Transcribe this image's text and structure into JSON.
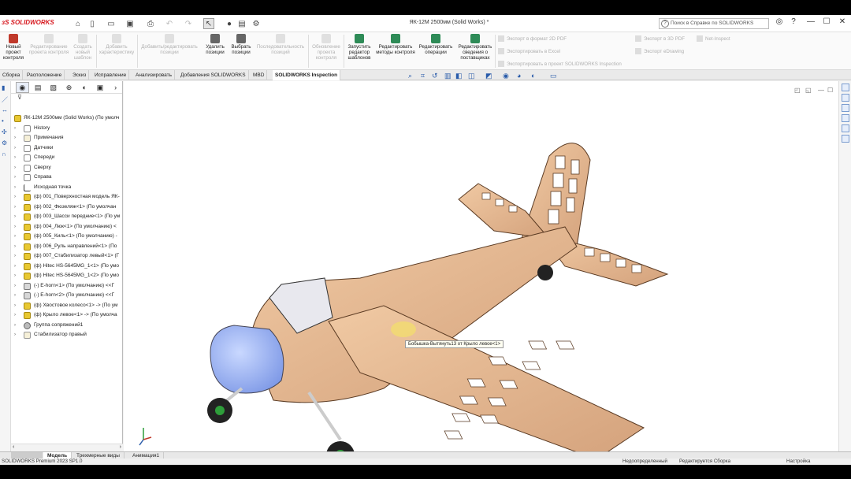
{
  "app": {
    "logo": "SOLIDWORKS",
    "title": "ЯК-12М 2500мм (Solid Works) *",
    "help_search_placeholder": "Поиск в Справке по SOLIDWORKS"
  },
  "commands": [
    {
      "label": "Новый проект контроля",
      "disabled": false,
      "color": "#c0392b"
    },
    {
      "label": "Редактирование проекта контроля",
      "disabled": true,
      "color": "#ddd"
    },
    {
      "label": "Создать новый шаблон",
      "disabled": true,
      "color": "#ddd"
    },
    {
      "label": "Добавить характеристику",
      "disabled": true,
      "color": "#ddd"
    },
    {
      "label": "Добавить/редактировать позиции",
      "disabled": true,
      "color": "#ddd"
    },
    {
      "label": "Удалить позиции",
      "disabled": false,
      "color": "#555"
    },
    {
      "label": "Выбрать позиции",
      "disabled": false,
      "color": "#555"
    },
    {
      "label": "Последовательность позиций",
      "disabled": true,
      "color": "#ddd"
    },
    {
      "label": "Обновление проекта контроля",
      "disabled": true,
      "color": "#ddd"
    },
    {
      "label": "Запустить редактор шаблонов",
      "disabled": false,
      "color": "#2e8b57"
    },
    {
      "label": "Редактировать методы контроля",
      "disabled": false,
      "color": "#2e8b57"
    },
    {
      "label": "Редактировать операции",
      "disabled": false,
      "color": "#2e8b57"
    },
    {
      "label": "Редактировать сведения о поставщиках",
      "disabled": false,
      "color": "#2e8b57"
    }
  ],
  "export": {
    "pdf2d": "Экспорт в формат 2D PDF",
    "excel": "Экспортировать в Excel",
    "project": "Экспортировать в проект SOLIDWORKS Inspection",
    "pdf3d": "Экспорт в 3D PDF",
    "edrawing": "Экспорт eDrawing",
    "netinspect": "Net-Inspect"
  },
  "tabs": [
    "Сборка",
    "Расположение",
    "Эскиз",
    "Исправление",
    "Анализировать",
    "Добавления SOLIDWORKS",
    "MBD",
    "SOLIDWORKS Inspection"
  ],
  "active_tab": "SOLIDWORKS Inspection",
  "tree": [
    {
      "label": "ЯК-12М 2500мм (Solid Works)  (По умолч",
      "icon": "asm",
      "root": true
    },
    {
      "label": "History",
      "icon": "hist"
    },
    {
      "label": "Примечания",
      "icon": "fold"
    },
    {
      "label": "Датчики",
      "icon": "sens"
    },
    {
      "label": "Спереди",
      "icon": "plane"
    },
    {
      "label": "Сверху",
      "icon": "plane"
    },
    {
      "label": "Справа",
      "icon": "plane"
    },
    {
      "label": "Исходная точка",
      "icon": "orig"
    },
    {
      "label": "(ф) 001_Поверхностная модель ЯК-",
      "icon": "asm"
    },
    {
      "label": "(ф) 002_Фюзеляж<1> (По умолчан",
      "icon": "asm"
    },
    {
      "label": "(ф) 003_Шасси передние<1> (По ум",
      "icon": "asm"
    },
    {
      "label": "(ф) 004_Люк<1> (По умолчанию) <",
      "icon": "asm"
    },
    {
      "label": "(ф) 005_Киль<1> (По умолчанию) -",
      "icon": "asm"
    },
    {
      "label": "(ф) 006_Руль направлений<1> (По",
      "icon": "asm"
    },
    {
      "label": "(ф) 007_Стабилизатор левый<1> (Г",
      "icon": "asm"
    },
    {
      "label": "(ф) Hitec HS-5645MG_1<1> (По умо",
      "icon": "asm"
    },
    {
      "label": "(ф) Hitec HS-5645MG_1<2> (По умо",
      "icon": "asm"
    },
    {
      "label": "(-) E-horn<1> (По умолчанию) <<Г",
      "icon": "part"
    },
    {
      "label": "(-) E-horn<2> (По умолчанию) <<Г",
      "icon": "part"
    },
    {
      "label": "(ф) Хвостовое колесо<1> -> (По ум",
      "icon": "asm"
    },
    {
      "label": "(ф) Крыло левое<1> -> (По умолча",
      "icon": "asm"
    },
    {
      "label": "Группа сопряжений1",
      "icon": "mate"
    },
    {
      "label": "Стабилизатор правый",
      "icon": "fold"
    }
  ],
  "tooltip": "Бобышка-Вытянуть13 от Крыло левое<1>",
  "bottom_tabs": [
    "Модель",
    "Трехмерные виды",
    "Анимация1"
  ],
  "status": {
    "version": "SOLIDWORKS Premium 2023 SP1.0",
    "defined": "Недоопределенный",
    "editing": "Редактируется Сборка",
    "custom": "Настройка"
  }
}
